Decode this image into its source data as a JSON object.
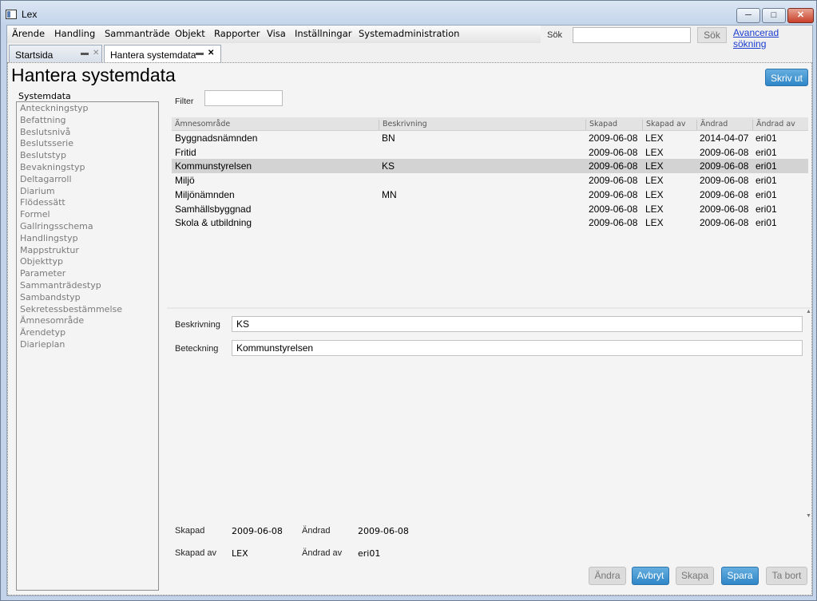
{
  "window": {
    "title": "Lex"
  },
  "menu": [
    "Ärende",
    "Handling",
    "Sammanträde",
    "Objekt",
    "Rapporter",
    "Visa",
    "Inställningar",
    "Systemadministration"
  ],
  "search": {
    "label": "Sök",
    "value": "",
    "button": "Sök",
    "advanced_link": "Avancerad sökning"
  },
  "tabs": [
    {
      "label": "Startsida",
      "active": false
    },
    {
      "label": "Hantera systemdata",
      "active": true
    }
  ],
  "page": {
    "title": "Hantera systemdata",
    "print_button": "Skriv ut"
  },
  "sidebar": {
    "legend": "Systemdata",
    "items": [
      "Anteckningstyp",
      "Befattning",
      "Beslutsnivå",
      "Beslutsserie",
      "Beslutstyp",
      "Bevakningstyp",
      "Deltagarroll",
      "Diarium",
      "Flödessätt",
      "Formel",
      "Gallringsschema",
      "Handlingstyp",
      "Mappstruktur",
      "Objekttyp",
      "Parameter",
      "Sammanträdestyp",
      "Sambandstyp",
      "Sekretessbestämmelse",
      "Ämnesområde",
      "Ärendetyp",
      "Diarieplan"
    ]
  },
  "filter": {
    "label": "Filter",
    "value": ""
  },
  "grid": {
    "columns": [
      "Ämnesområde",
      "Beskrivning",
      "Skapad",
      "Skapad av",
      "Ändrad",
      "Ändrad av"
    ],
    "rows": [
      [
        "Byggnadsnämnden",
        "BN",
        "2009-06-08",
        "LEX",
        "2014-04-07",
        "eri01"
      ],
      [
        "Fritid",
        "",
        "2009-06-08",
        "LEX",
        "2009-06-08",
        "eri01"
      ],
      [
        "Kommunstyrelsen",
        "KS",
        "2009-06-08",
        "LEX",
        "2009-06-08",
        "eri01"
      ],
      [
        "Miljö",
        "",
        "2009-06-08",
        "LEX",
        "2009-06-08",
        "eri01"
      ],
      [
        "Miljönämnden",
        "MN",
        "2009-06-08",
        "LEX",
        "2009-06-08",
        "eri01"
      ],
      [
        "Samhällsbyggnad",
        "",
        "2009-06-08",
        "LEX",
        "2009-06-08",
        "eri01"
      ],
      [
        "Skola & utbildning",
        "",
        "2009-06-08",
        "LEX",
        "2009-06-08",
        "eri01"
      ]
    ],
    "selected_row": 2
  },
  "form": {
    "beskrivning_label": "Beskrivning",
    "beskrivning_value": "KS",
    "beteckning_label": "Beteckning",
    "beteckning_value": "Kommunstyrelsen"
  },
  "meta": {
    "skapad_label": "Skapad",
    "skapad_value": "2009-06-08",
    "andrad_label": "Ändrad",
    "andrad_value": "2009-06-08",
    "skapad_av_label": "Skapad av",
    "skapad_av_value": "LEX",
    "andrad_av_label": "Ändrad av",
    "andrad_av_value": "eri01"
  },
  "buttons": {
    "andra": "Ändra",
    "avbryt": "Avbryt",
    "skapa": "Skapa",
    "spara": "Spara",
    "ta_bort": "Ta bort"
  },
  "colors": {
    "accent": "#2f86c7",
    "selected_row": "#d3d3d3",
    "link": "#1a3ccf"
  }
}
